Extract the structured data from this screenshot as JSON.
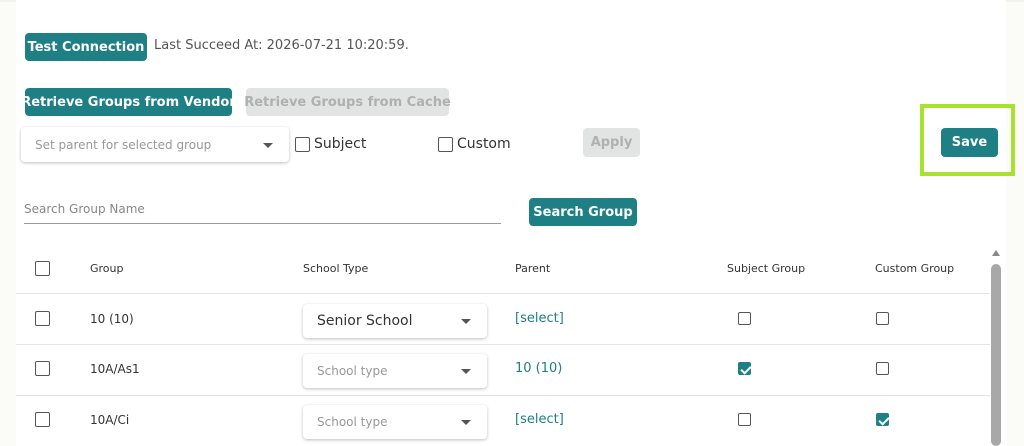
{
  "toolbar": {
    "test_connection_label": "Test Connection",
    "last_succeed_text": "Last Succeed At: 2026-07-21 10:20:59.",
    "retrieve_vendor_label": "Retrieve Groups from Vendor",
    "retrieve_cache_label": "Retrieve Groups from Cache",
    "save_label": "Save"
  },
  "bulk": {
    "parent_placeholder": "Set parent for selected group",
    "subject_label": "Subject",
    "custom_label": "Custom",
    "apply_label": "Apply"
  },
  "search": {
    "placeholder": "Search Group Name",
    "button_label": "Search Group"
  },
  "table": {
    "headers": {
      "group": "Group",
      "school_type": "School Type",
      "parent": "Parent",
      "subject_group": "Subject Group",
      "custom_group": "Custom Group"
    },
    "rows": [
      {
        "selected": false,
        "group": "10 (10)",
        "school_type": "Senior School",
        "school_type_placeholder": false,
        "parent": "[select]",
        "subject": false,
        "custom": false
      },
      {
        "selected": false,
        "group": "10A/As1",
        "school_type": "School type",
        "school_type_placeholder": true,
        "parent": "10 (10)",
        "subject": true,
        "custom": false
      },
      {
        "selected": false,
        "group": "10A/Ci",
        "school_type": "School type",
        "school_type_placeholder": true,
        "parent": "[select]",
        "subject": false,
        "custom": true
      }
    ]
  },
  "colors": {
    "accent": "#1e8085",
    "highlight": "#a6e22e",
    "disabled": "#e2e3e3"
  }
}
